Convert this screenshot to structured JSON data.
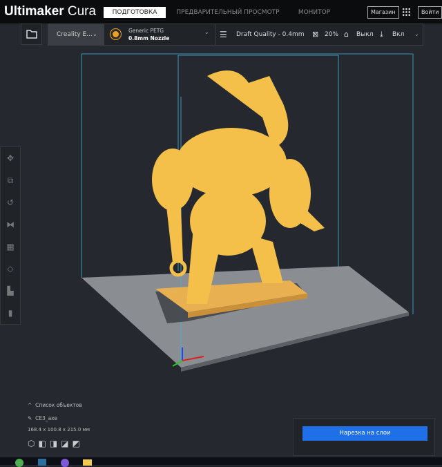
{
  "header": {
    "brand_bold": "Ultimaker",
    "brand_light": " Cura",
    "tabs": [
      {
        "label": "ПОДГОТОВКА",
        "active": true
      },
      {
        "label": "ПРЕДВАРИТЕЛЬНЫЙ ПРОСМОТР"
      },
      {
        "label": "МОНИТОР"
      }
    ],
    "marketplace": "Магазин",
    "signin": "Войти"
  },
  "toolbar": {
    "printer": "Creality E...",
    "material_name": "Generic PETG",
    "nozzle": "0.8mm Nozzle",
    "extruder_num": "1",
    "quality": "Draft Quality - 0.4mm",
    "infill": "20%",
    "support": "Выкл",
    "adhesion": "Вкл"
  },
  "objects": {
    "toggle": "Список объектов",
    "name": "CE3_axe",
    "dimensions": "168.4 x 100.8 x 215.0 мм"
  },
  "slice": {
    "button": "Нарезка на слои"
  },
  "colors": {
    "accent": "#1f6fe8",
    "model": "#f5c04a",
    "base": "#e8b050",
    "plate": "#8a8d92"
  }
}
